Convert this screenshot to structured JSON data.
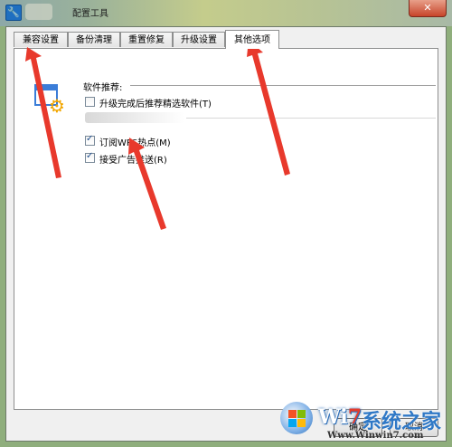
{
  "window": {
    "title": "配置工具",
    "close_glyph": "✕"
  },
  "tabs": [
    {
      "label": "兼容设置",
      "active": false
    },
    {
      "label": "备份清理",
      "active": false
    },
    {
      "label": "重置修复",
      "active": false
    },
    {
      "label": "升级设置",
      "active": false
    },
    {
      "label": "其他选项",
      "active": true
    }
  ],
  "panel": {
    "software_section_label": "软件推荐:",
    "options": [
      {
        "label": "升级完成后推荐精选软件(T)",
        "checked": false
      },
      {
        "label": "订阅WPS热点(M)",
        "checked": true
      },
      {
        "label": "接受广告推送(R)",
        "checked": true
      }
    ]
  },
  "footer": {
    "ok_label": "确定",
    "cancel_label": "取消"
  },
  "watermark": {
    "brand_win": "Wi",
    "brand_seven": "7",
    "brand_cn": "系统之家",
    "url": "Www.Winwin7.com"
  },
  "colors": {
    "accent_arrow": "#e8392c",
    "selection_blue": "#3b7dd8"
  }
}
